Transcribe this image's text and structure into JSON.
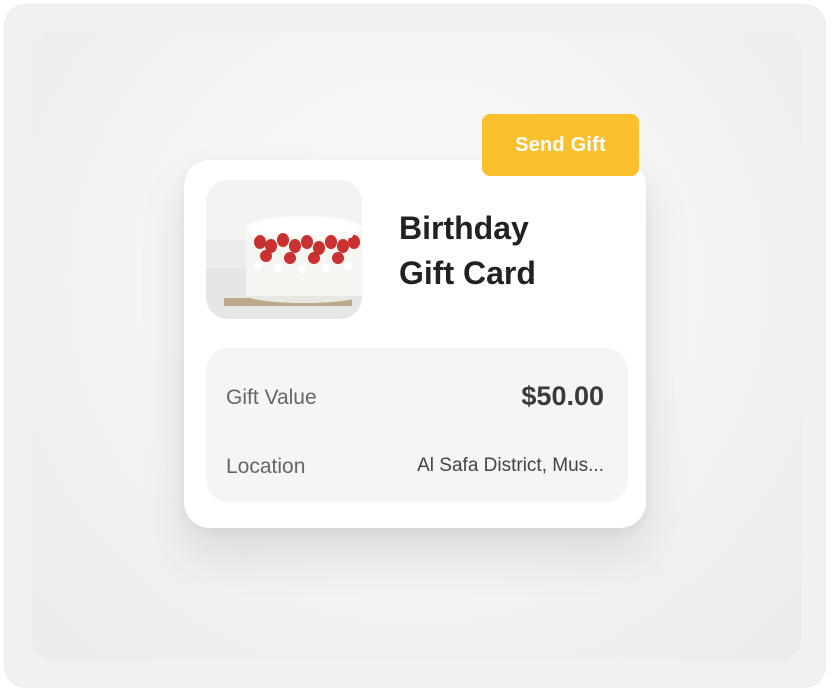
{
  "send_gift": {
    "label": "Send Gift"
  },
  "card": {
    "title_line1": "Birthday",
    "title_line2": "Gift Card",
    "image_alt": "strawberry-cake"
  },
  "details": {
    "gift_value_label": "Gift Value",
    "gift_value": "$50.00",
    "location_label": "Location",
    "location_value": "Al Safa District, Mus..."
  },
  "colors": {
    "accent": "#fbc02d",
    "card_bg": "#ffffff",
    "details_bg": "#f5f5f5"
  }
}
